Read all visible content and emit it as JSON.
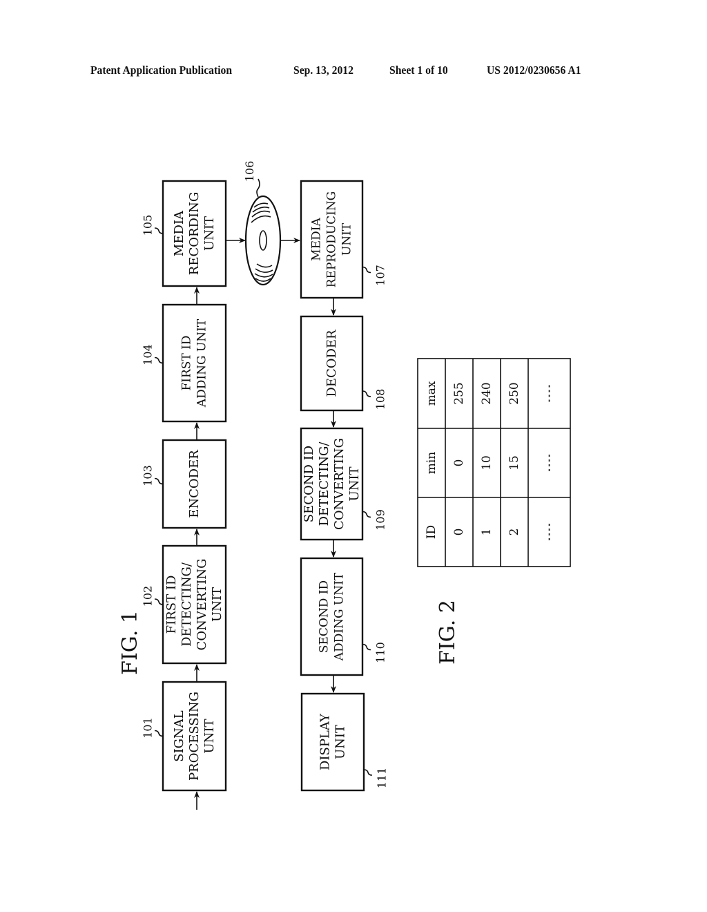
{
  "header": {
    "publication": "Patent Application Publication",
    "date": "Sep. 13, 2012",
    "sheet": "Sheet 1 of 10",
    "number": "US 2012/0230656 A1"
  },
  "fig1": {
    "title": "FIG. 1",
    "disc_ref": "106",
    "blocks": [
      {
        "ref": "101",
        "lines": [
          "SIGNAL",
          "PROCESSING",
          "UNIT"
        ]
      },
      {
        "ref": "102",
        "lines": [
          "FIRST ID",
          "DETECTING/",
          "CONVERTING",
          "UNIT"
        ]
      },
      {
        "ref": "103",
        "lines": [
          "ENCODER"
        ]
      },
      {
        "ref": "104",
        "lines": [
          "FIRST ID",
          "ADDING UNIT"
        ]
      },
      {
        "ref": "105",
        "lines": [
          "MEDIA",
          "RECORDING",
          "UNIT"
        ]
      },
      {
        "ref": "107",
        "lines": [
          "MEDIA",
          "REPRODUCING",
          "UNIT"
        ]
      },
      {
        "ref": "108",
        "lines": [
          "DECODER"
        ]
      },
      {
        "ref": "109",
        "lines": [
          "SECOND ID",
          "DETECTING/",
          "CONVERTING",
          "UNIT"
        ]
      },
      {
        "ref": "110",
        "lines": [
          "SECOND ID",
          "ADDING UNIT"
        ]
      },
      {
        "ref": "111",
        "lines": [
          "DISPLAY",
          "UNIT"
        ]
      }
    ]
  },
  "fig2": {
    "title": "FIG. 2",
    "headers": [
      "ID",
      "min",
      "max"
    ],
    "rows": [
      [
        "0",
        "0",
        "255"
      ],
      [
        "1",
        "10",
        "240"
      ],
      [
        "2",
        "15",
        "250"
      ],
      [
        "....",
        "....",
        "...."
      ]
    ]
  }
}
